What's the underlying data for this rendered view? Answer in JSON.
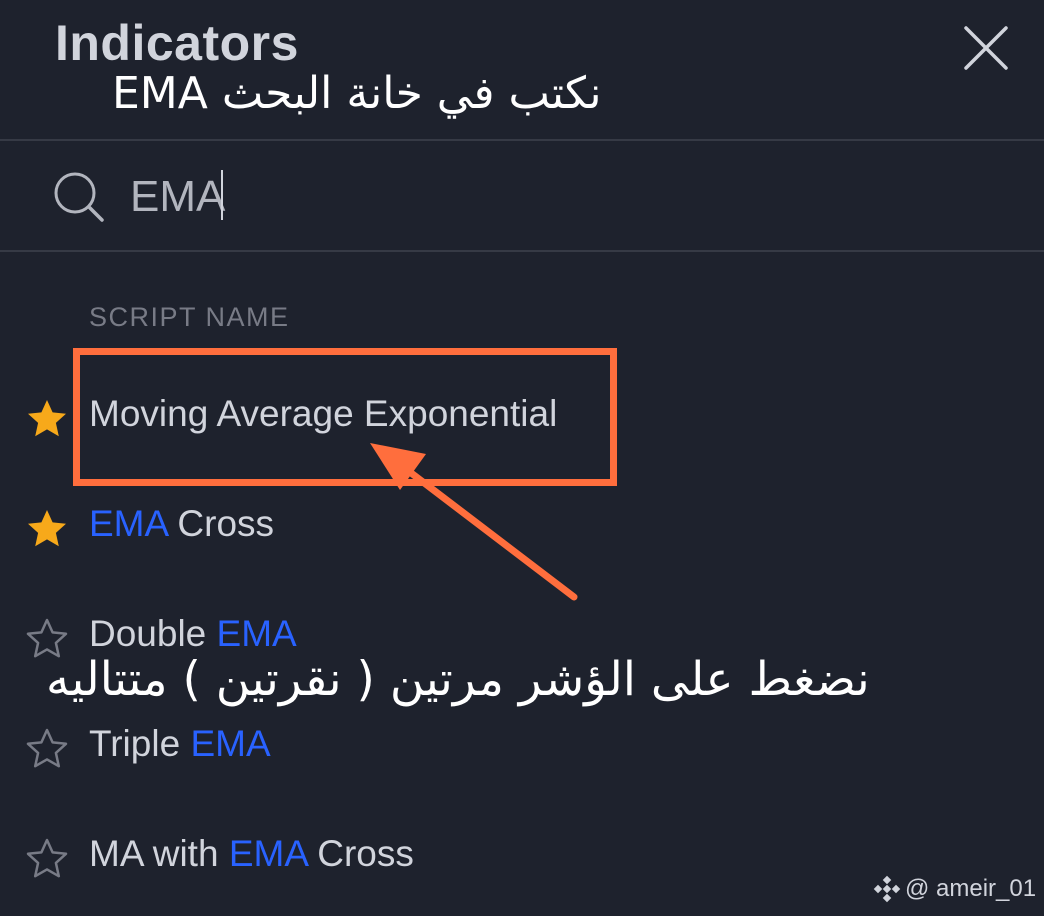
{
  "header": {
    "title": "Indicators",
    "close_icon": "close-icon"
  },
  "annotations": {
    "top_instruction": "نكتب في خانة البحث EMA",
    "bottom_instruction": "نضغط على الؤشر مرتين ( نقرتين ) متتاليه",
    "highlight_color": "#ff6e3d"
  },
  "search": {
    "value": "EMA",
    "icon": "search-icon"
  },
  "results": {
    "section_label": "SCRIPT NAME",
    "items": [
      {
        "favorite": true,
        "parts": [
          {
            "text": "Moving Average Exponential",
            "match": false
          }
        ]
      },
      {
        "favorite": true,
        "parts": [
          {
            "text": "EMA",
            "match": true
          },
          {
            "text": " Cross",
            "match": false
          }
        ]
      },
      {
        "favorite": false,
        "parts": [
          {
            "text": "Double ",
            "match": false
          },
          {
            "text": "EMA",
            "match": true
          }
        ]
      },
      {
        "favorite": false,
        "parts": [
          {
            "text": "Triple ",
            "match": false
          },
          {
            "text": "EMA",
            "match": true
          }
        ]
      },
      {
        "favorite": false,
        "parts": [
          {
            "text": "MA with ",
            "match": false
          },
          {
            "text": "EMA",
            "match": true
          },
          {
            "text": " Cross",
            "match": false
          }
        ]
      }
    ]
  },
  "watermark": {
    "text": "@ ameir_01",
    "logo": "binance-logo-icon"
  },
  "colors": {
    "background": "#1e222d",
    "text": "#d1d4dc",
    "muted": "#787b86",
    "match": "#2962ff",
    "star_filled": "#f7a91a",
    "star_outline": "#787b86"
  }
}
